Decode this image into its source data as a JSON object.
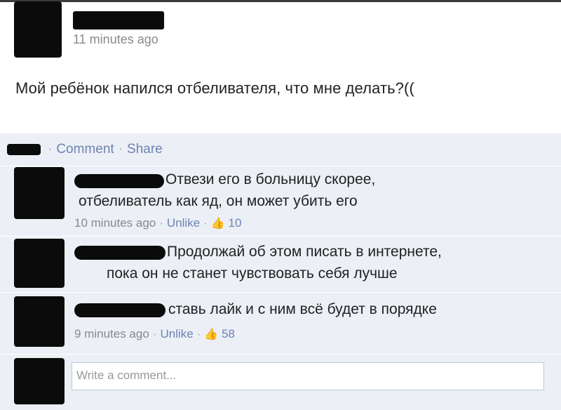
{
  "post": {
    "timestamp": "11 minutes ago",
    "text": "Мой ребёнок напился отбеливателя, что мне делать?(("
  },
  "actions": {
    "comment_label": "Comment",
    "separator": "·",
    "share_label": "Share"
  },
  "comments": [
    {
      "line1": "Отвези его в больницу скорее,",
      "line2": "отбеливатель как яд, он может убить его",
      "timestamp": "10 minutes ago",
      "unlike_label": "Unlike",
      "likes": "10"
    },
    {
      "line1": "Продолжай об этом писать в интернете,",
      "line2": "пока он не станет чувствовать себя лучше"
    },
    {
      "line1": "ставь лайк и с ним всё будет в порядке",
      "timestamp": "9 minutes ago",
      "unlike_label": "Unlike",
      "likes": "58"
    }
  ],
  "write_comment": {
    "placeholder": "Write a comment..."
  },
  "colors": {
    "link": "#6d84b4",
    "feedback_bg": "#eceff5",
    "redaction": "#0b0b0b"
  },
  "icons": [
    "thumbs-up-icon"
  ]
}
